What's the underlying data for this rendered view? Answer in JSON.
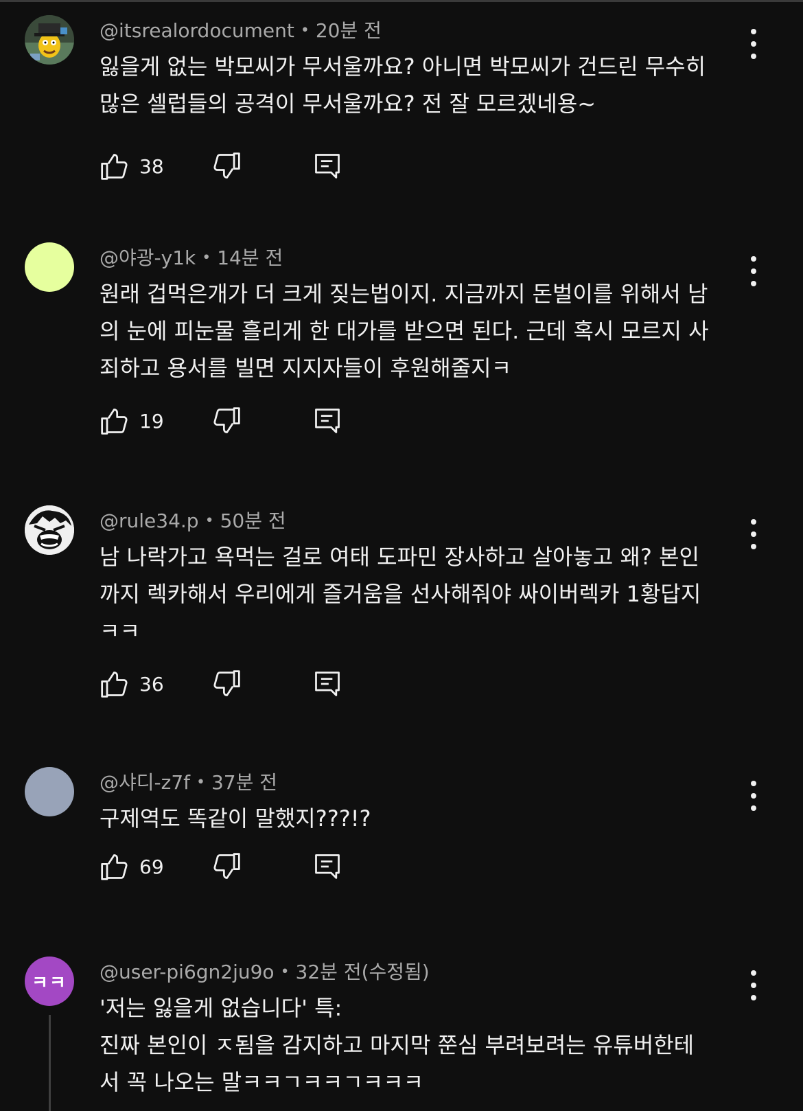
{
  "comments": [
    {
      "handle": "@itsrealordocument",
      "time": "20분 전",
      "text": "잃을게 없는 박모씨가 무서울까요? 아니면 박모씨가 건드린 무수히\n많은 셀럽들의 공격이 무서울까요? 전 잘 모르겠네용~",
      "likes": "38",
      "avatar": {
        "kind": "cartoon-character",
        "bg": "#2b3d2f"
      }
    },
    {
      "handle": "@야광-y1k",
      "time": "14분 전",
      "text": "원래 겁먹은개가 더 크게 짖는법이지. 지금까지 돈벌이를 위해서 남\n의 눈에 피눈물 흘리게 한 대가를 받으면 된다. 근데 혹시 모르지 사\n죄하고 용서를 빌면 지지자들이 후원해줄지ㅋ",
      "likes": "19",
      "avatar": {
        "kind": "solid",
        "bg": "#e6ff9e"
      }
    },
    {
      "handle": "@rule34.p",
      "time": "50분 전",
      "text": "남 나락가고 욕먹는 걸로 여태 도파민 장사하고 살아놓고 왜? 본인\n까지 렉카해서 우리에게 즐거움을 선사해줘야 싸이버렉카 1황답지\nㅋㅋ",
      "likes": "36",
      "avatar": {
        "kind": "manga-face",
        "bg": "#e8e8e8"
      }
    },
    {
      "handle": "@샤디-z7f",
      "time": "37분 전",
      "text": "구제역도 똑같이 말했지???!?",
      "likes": "69",
      "avatar": {
        "kind": "solid",
        "bg": "#98a3b8"
      }
    },
    {
      "handle": "@user-pi6gn2ju9o",
      "time": "32분 전(수정됨)",
      "text": "'저는 잃을게 없습니다' 특:\n진짜 본인이 ㅈ됨을 감지하고 마지막 쭌심 부려보려는 유튜버한테\n서 꼭 나오는 말ㅋㅋㄱㅋㅋㄱㅋㅋㅋ",
      "likes": "",
      "avatar": {
        "kind": "initials",
        "bg": "#a348c4",
        "initials": "ㅋㅋ"
      }
    }
  ],
  "icons": {
    "like": "thumbs-up-icon",
    "dislike": "thumbs-down-icon",
    "reply": "reply-comment-icon",
    "more": "more-vertical-icon"
  },
  "colors": {
    "background": "#0f0f0f",
    "text": "#f1f1f1",
    "meta": "#aaaaaa"
  }
}
